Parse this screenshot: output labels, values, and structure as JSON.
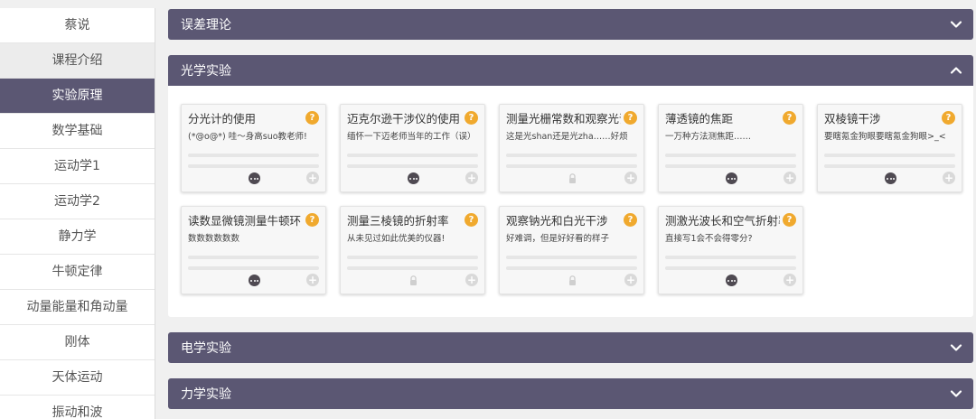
{
  "sidebar": {
    "items": [
      {
        "label": "蔡说",
        "state": "normal"
      },
      {
        "label": "课程介绍",
        "state": "light"
      },
      {
        "label": "实验原理",
        "state": "active"
      },
      {
        "label": "数学基础",
        "state": "normal"
      },
      {
        "label": "运动学1",
        "state": "normal"
      },
      {
        "label": "运动学2",
        "state": "normal"
      },
      {
        "label": "静力学",
        "state": "normal"
      },
      {
        "label": "牛顿定律",
        "state": "normal"
      },
      {
        "label": "动量能量和角动量",
        "state": "normal"
      },
      {
        "label": "刚体",
        "state": "normal"
      },
      {
        "label": "天体运动",
        "state": "normal"
      },
      {
        "label": "振动和波",
        "state": "normal"
      }
    ]
  },
  "panels": {
    "error_theory": {
      "title": "误差理论",
      "icon": "chevron-down-icon"
    },
    "optics": {
      "title": "光学实验",
      "icon": "chevron-up-icon",
      "cards": [
        {
          "title": "分光计的使用",
          "desc": "(*@o@*) 哇～身高suo教老师!",
          "status": "dots-icon"
        },
        {
          "title": "迈克尔逊干涉仪的使用",
          "desc": "缅怀一下迈老师当年的工作（误）",
          "status": "dots-icon"
        },
        {
          "title": "测量光栅常数和观察光谱",
          "desc": "这是光shan还是光zha……好烦",
          "status": "lock-icon"
        },
        {
          "title": "薄透镜的焦距",
          "desc": "一万种方法测焦距……",
          "status": "dots-icon"
        },
        {
          "title": "双棱镜干涉",
          "desc": "要瞎氪金狗眼要瞎氪金狗眼>_<",
          "status": "dots-icon"
        },
        {
          "title": "读数显微镜测量牛顿环",
          "desc": "数数数数数数",
          "status": "dots-icon"
        },
        {
          "title": "测量三棱镜的折射率",
          "desc": "从未见过如此优美的仪器!",
          "status": "lock-icon"
        },
        {
          "title": "观察钠光和白光干涉",
          "desc": "好难调，但是好好看的样子",
          "status": "lock-icon"
        },
        {
          "title": "测激光波长和空气折射率",
          "desc": "直接写1会不会得零分?",
          "status": "dots-icon"
        }
      ]
    },
    "electric": {
      "title": "电学实验",
      "icon": "chevron-down-icon"
    },
    "mechanics": {
      "title": "力学实验",
      "icon": "chevron-down-icon"
    }
  },
  "icons": {
    "question_mark": "?",
    "plus": "+"
  },
  "colors": {
    "header": "#5b5773",
    "question_badge": "#f0a92e",
    "active_item": "#5b5773"
  }
}
